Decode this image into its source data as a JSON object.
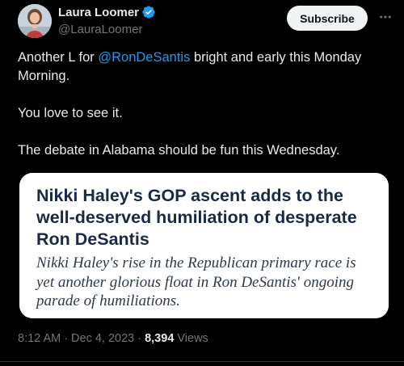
{
  "author": {
    "name": "Laura Loomer",
    "handle": "@LauraLoomer",
    "verified": true,
    "verified_color": "#1d9bf0"
  },
  "actions": {
    "subscribe_label": "Subscribe",
    "more_icon": "more-horizontal-icon"
  },
  "post": {
    "line1_before": "Another L for ",
    "mention": "@RonDeSantis",
    "line1_after": " bright and early this Monday Morning.",
    "line2": "You love to see it.",
    "line3": "The debate in Alabama should be fun this Wednesday."
  },
  "card": {
    "headline": "Nikki Haley's GOP ascent adds to the well-deserved humiliation of desperate Ron DeSantis",
    "subheadline": "Nikki Haley's rise in the Republican primary race is yet another glorious float in Ron DeSantis' ongoing parade of humiliations."
  },
  "meta": {
    "time": "8:12 AM",
    "separator": "·",
    "date": "Dec 4, 2023",
    "views_count": "8,394",
    "views_label": "Views"
  },
  "colors": {
    "background": "#000000",
    "text": "#e7e9ea",
    "muted": "#71767b",
    "link": "#1d9bf0"
  }
}
